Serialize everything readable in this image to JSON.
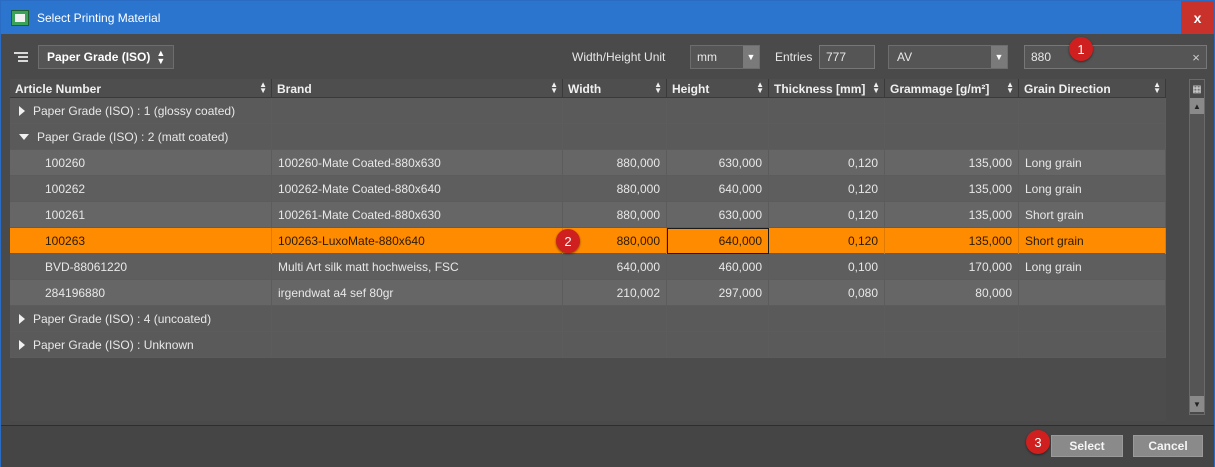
{
  "window": {
    "title": "Select Printing Material",
    "close_label": "x"
  },
  "toolbar": {
    "grouping_label": "Paper Grade (ISO)",
    "unit_label": "Width/Height Unit",
    "unit_value": "mm",
    "entries_label": "Entries",
    "entries_value": "777",
    "filter_value": "AV",
    "search_value": "880",
    "clear_label": "×"
  },
  "badges": [
    "1",
    "2",
    "3"
  ],
  "table": {
    "headers": [
      "Article Number",
      "Brand",
      "Width",
      "Height",
      "Thickness [mm]",
      "Grammage [g/m²]",
      "Grain Direction"
    ],
    "groups": [
      {
        "label": "Paper Grade (ISO) : 1 (glossy coated)",
        "expanded": false
      },
      {
        "label": "Paper Grade (ISO) : 2 (matt coated)",
        "expanded": true
      },
      {
        "label": "Paper Grade (ISO) : 4 (uncoated)",
        "expanded": false
      },
      {
        "label": "Paper Grade (ISO) : Unknown",
        "expanded": false
      }
    ],
    "rows": [
      [
        "100260",
        "100260-Mate Coated-880x630",
        "880,000",
        "630,000",
        "0,120",
        "135,000",
        "Long grain"
      ],
      [
        "100262",
        "100262-Mate Coated-880x640",
        "880,000",
        "640,000",
        "0,120",
        "135,000",
        "Long grain"
      ],
      [
        "100261",
        "100261-Mate Coated-880x630",
        "880,000",
        "630,000",
        "0,120",
        "135,000",
        "Short grain"
      ],
      [
        "100263",
        "100263-LuxoMate-880x640",
        "880,000",
        "640,000",
        "0,120",
        "135,000",
        "Short grain"
      ],
      [
        "BVD-88061220",
        "Multi Art silk matt hochweiss, FSC",
        "640,000",
        "460,000",
        "0,100",
        "170,000",
        "Long grain"
      ],
      [
        "284196880",
        "irgendwat a4 sef 80gr",
        "210,002",
        "297,000",
        "0,080",
        "80,000",
        ""
      ]
    ],
    "selected_row_index": 3
  },
  "footer": {
    "select_label": "Select",
    "cancel_label": "Cancel"
  },
  "colors": {
    "title_bar": "#2b75cf",
    "selection": "#ff8c00",
    "badge": "#d01f1f",
    "close": "#c8322b"
  }
}
